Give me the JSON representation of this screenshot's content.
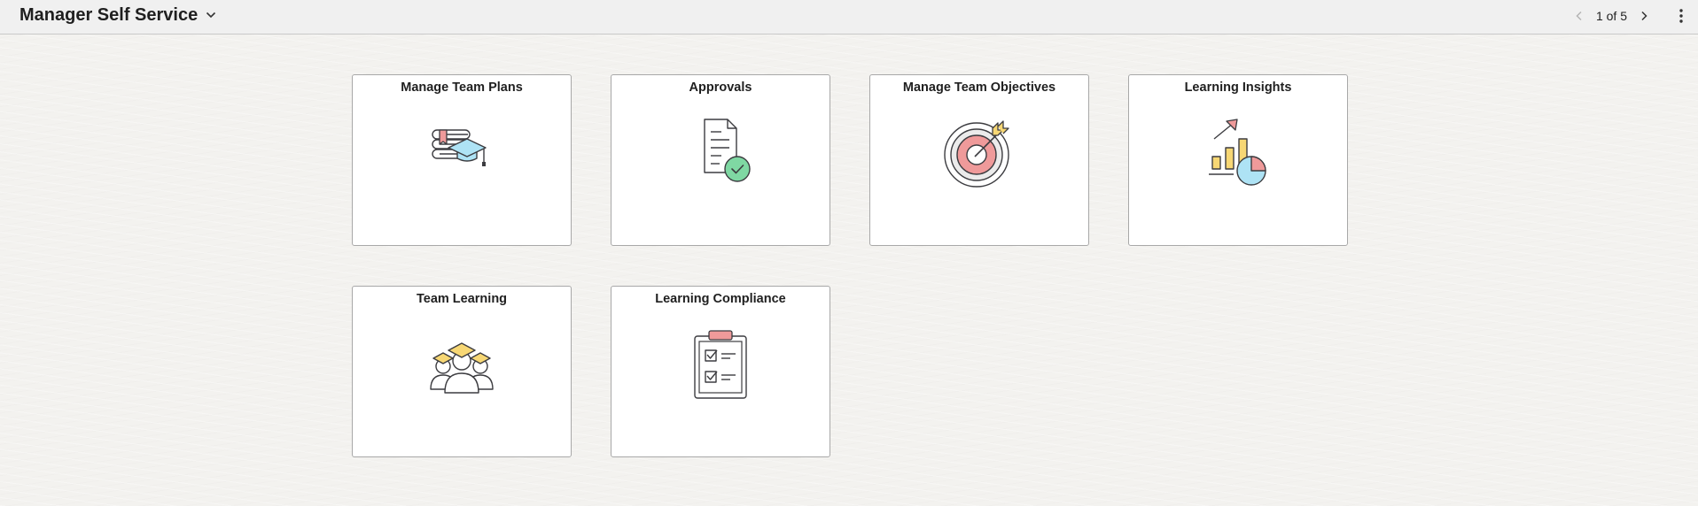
{
  "header": {
    "title": "Manager Self Service",
    "title_icon": "chevron-down-icon",
    "pager": {
      "text": "1 of 5",
      "prev_icon": "chevron-left-icon",
      "next_icon": "chevron-right-icon"
    },
    "more_icon": "vertical-ellipsis-icon"
  },
  "tiles": [
    {
      "label": "Manage Team Plans",
      "icon": "books-graduation-cap-icon"
    },
    {
      "label": "Approvals",
      "icon": "document-checkmark-icon"
    },
    {
      "label": "Manage Team Objectives",
      "icon": "target-arrow-icon"
    },
    {
      "label": "Learning Insights",
      "icon": "bar-pie-chart-icon"
    },
    {
      "label": "Team Learning",
      "icon": "team-graduates-icon"
    },
    {
      "label": "Learning Compliance",
      "icon": "clipboard-checklist-icon"
    }
  ],
  "colors": {
    "header_bg": "#f0f0f0",
    "page_bg": "#f3f2ef",
    "tile_bg": "#ffffff",
    "tile_border": "#a8a8a8",
    "icon_red": "#ef9a9a",
    "icon_blue": "#aee3f5",
    "icon_yellow": "#f7d774",
    "icon_green": "#7fd8a3",
    "icon_stroke": "#3c3c40"
  }
}
